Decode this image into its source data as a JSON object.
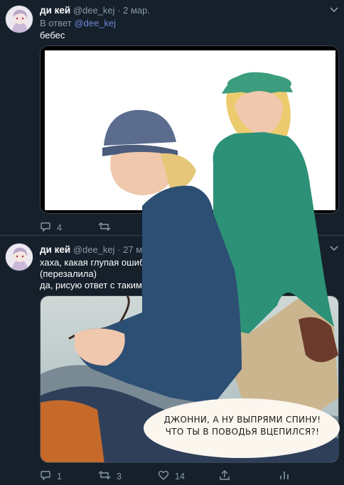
{
  "tweet1": {
    "display_name": "ди кей",
    "handle": "@dee_kej",
    "separator": "·",
    "date": "2 мар.",
    "reply_prefix": "В ответ",
    "reply_to": "@dee_kej",
    "text": "бебес",
    "replies": "4"
  },
  "tweet2": {
    "display_name": "ди кей",
    "handle": "@dee_kej",
    "separator": "·",
    "date_partial": "27 ми",
    "text_line1": "хаха, какая глупая ошиб",
    "text_line2": "(перезалила)",
    "text_line3": "да, рисую ответ с таким",
    "replies": "1",
    "retweets": "3",
    "likes": "14"
  },
  "speech_bubble": {
    "line1": "ДЖОННИ, А НУ ВЫПРЯМИ СПИНУ!",
    "line2": "ЧТО ТЫ В ПОВОДЬЯ ВЦЕПИЛСЯ?!"
  },
  "colors": {
    "background": "#15202b",
    "link": "#6f87d6",
    "muted": "#8899a6",
    "divider": "#38444d"
  }
}
